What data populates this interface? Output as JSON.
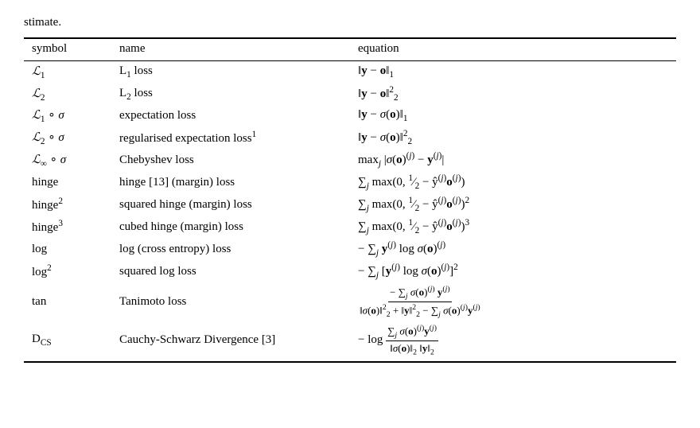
{
  "intro": "stimate.",
  "table": {
    "headers": [
      "symbol",
      "name",
      "equation"
    ],
    "rows": [
      {
        "symbol_html": "<i>ℒ</i><sub>1</sub>",
        "name_html": "L<sub>1</sub> loss",
        "equation_html": "‖<b>y</b> − <b>o</b>‖<sub>1</sub>"
      },
      {
        "symbol_html": "<i>ℒ</i><sub>2</sub>",
        "name_html": "L<sub>2</sub> loss",
        "equation_html": "‖<b>y</b> − <b>o</b>‖<sup>2</sup><sub>2</sub>"
      },
      {
        "symbol_html": "<i>ℒ</i><sub>1</sub> ∘ <i>σ</i>",
        "name_html": "expectation loss",
        "equation_html": "‖<b>y</b> − <i>σ</i>(<b>o</b>)‖<sub>1</sub>"
      },
      {
        "symbol_html": "<i>ℒ</i><sub>2</sub> ∘ <i>σ</i>",
        "name_html": "regularised expectation loss<sup>1</sup>",
        "equation_html": "‖<b>y</b> − <i>σ</i>(<b>o</b>)‖<sup>2</sup><sub>2</sub>"
      },
      {
        "symbol_html": "<i>ℒ</i><sub>∞</sub> ∘ <i>σ</i>",
        "name_html": "Chebyshev loss",
        "equation_html": "max<sub><i>j</i></sub> |<i>σ</i>(<b>o</b>)<sup>(<i>j</i>)</sup> − <b>y</b><sup>(<i>j</i>)</sup>|"
      },
      {
        "symbol_html": "hinge",
        "name_html": "hinge [13] (margin) loss",
        "equation_html": "∑<sub><i>j</i></sub> max(0, <sup>1</sup>⁄<sub>2</sub> − ŷ<sup>(<i>j</i>)</sup><b>o</b><sup>(<i>j</i>)</sup>)"
      },
      {
        "symbol_html": "hinge<sup>2</sup>",
        "name_html": "squared hinge (margin) loss",
        "equation_html": "∑<sub><i>j</i></sub> max(0, <sup>1</sup>⁄<sub>2</sub> − ŷ<sup>(<i>j</i>)</sup><b>o</b><sup>(<i>j</i>)</sup>)<sup>2</sup>"
      },
      {
        "symbol_html": "hinge<sup>3</sup>",
        "name_html": "cubed hinge (margin) loss",
        "equation_html": "∑<sub><i>j</i></sub> max(0, <sup>1</sup>⁄<sub>2</sub> − ŷ<sup>(<i>j</i>)</sup><b>o</b><sup>(<i>j</i>)</sup>)<sup>3</sup>"
      },
      {
        "symbol_html": "log",
        "name_html": "log (cross entropy) loss",
        "equation_html": "− ∑<sub><i>j</i></sub> <b>y</b><sup>(<i>j</i>)</sup> log <i>σ</i>(<b>o</b>)<sup>(<i>j</i>)</sup>"
      },
      {
        "symbol_html": "log<sup>2</sup>",
        "name_html": "squared log loss",
        "equation_html": "− ∑<sub><i>j</i></sub> [<b>y</b><sup>(<i>j</i>)</sup> log <i>σ</i>(<b>o</b>)<sup>(<i>j</i>)</sup>]<sup>2</sup>"
      },
      {
        "symbol_html": "tan",
        "name_html": "Tanimoto loss",
        "equation_type": "fraction",
        "eq_numerator": "− ∑<sub><i>j</i></sub> <i>σ</i>(<b>o</b>)<sup>(<i>j</i>)</sup> <b>y</b><sup>(<i>j</i>)</sup>",
        "eq_denominator": "‖<i>σ</i>(<b>o</b>)‖<sup>2</sup><sub>2</sub> + ‖<b>y</b>‖<sup>2</sup><sub>2</sub> − ∑<sub><i>j</i></sub> <i>σ</i>(<b>o</b>)<sup>(<i>j</i>)</sup><b>y</b><sup>(<i>j</i>)</sup>"
      },
      {
        "symbol_html": "D<sub>CS</sub>",
        "name_html": "Cauchy-Schwarz Divergence [3]",
        "equation_type": "fraction",
        "eq_prefix": "− log ",
        "eq_numerator": "∑<sub><i>j</i></sub> <i>σ</i>(<b>o</b>)<sup>(<i>j</i>)</sup><b>y</b><sup>(<i>j</i>)</sup>",
        "eq_denominator": "‖<i>σ</i>(<b>o</b>)‖<sub>2</sub> ‖<b>y</b>‖<sub>2</sub>"
      }
    ]
  }
}
